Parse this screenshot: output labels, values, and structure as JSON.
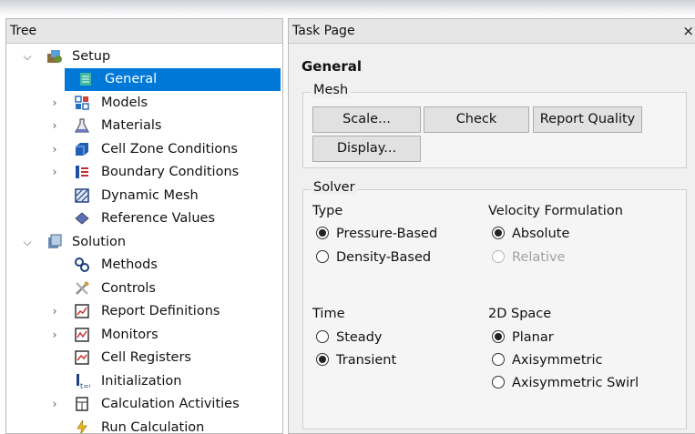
{
  "tree": {
    "title": "Tree",
    "items": [
      {
        "label": "Setup",
        "icon": "setup-icon",
        "expander": "expanded"
      },
      {
        "label": "General",
        "icon": "general-icon",
        "expander": "none",
        "selected": true
      },
      {
        "label": "Models",
        "icon": "models-icon",
        "expander": "collapsed"
      },
      {
        "label": "Materials",
        "icon": "materials-icon",
        "expander": "collapsed"
      },
      {
        "label": "Cell Zone Conditions",
        "icon": "cell-zone-icon",
        "expander": "collapsed"
      },
      {
        "label": "Boundary Conditions",
        "icon": "boundary-icon",
        "expander": "collapsed"
      },
      {
        "label": "Dynamic Mesh",
        "icon": "dynamic-mesh-icon",
        "expander": "none"
      },
      {
        "label": "Reference Values",
        "icon": "reference-values-icon",
        "expander": "none"
      },
      {
        "label": "Solution",
        "icon": "solution-icon",
        "expander": "expanded"
      },
      {
        "label": "Methods",
        "icon": "methods-icon",
        "expander": "none"
      },
      {
        "label": "Controls",
        "icon": "controls-icon",
        "expander": "none"
      },
      {
        "label": "Report Definitions",
        "icon": "report-definitions-icon",
        "expander": "collapsed"
      },
      {
        "label": "Monitors",
        "icon": "monitors-icon",
        "expander": "collapsed"
      },
      {
        "label": "Cell Registers",
        "icon": "cell-registers-icon",
        "expander": "none"
      },
      {
        "label": "Initialization",
        "icon": "initialization-icon",
        "expander": "none"
      },
      {
        "label": "Calculation Activities",
        "icon": "calculation-activities-icon",
        "expander": "collapsed"
      },
      {
        "label": "Run Calculation",
        "icon": "run-calculation-icon",
        "expander": "none"
      }
    ]
  },
  "task": {
    "title": "Task Page",
    "close": "×",
    "heading": "General",
    "mesh": {
      "title": "Mesh",
      "scale": "Scale...",
      "check": "Check",
      "report_quality": "Report Quality",
      "display": "Display..."
    },
    "solver": {
      "title": "Solver",
      "type_label": "Type",
      "pressure_based": "Pressure-Based",
      "density_based": "Density-Based",
      "velocity_label": "Velocity Formulation",
      "absolute": "Absolute",
      "relative": "Relative",
      "time_label": "Time",
      "steady": "Steady",
      "transient": "Transient",
      "space_label": "2D Space",
      "planar": "Planar",
      "axisymmetric": "Axisymmetric",
      "axisymmetric_swirl": "Axisymmetric Swirl"
    }
  },
  "colors": {
    "selection": "#0078d7",
    "panel": "#f0f0f0"
  }
}
